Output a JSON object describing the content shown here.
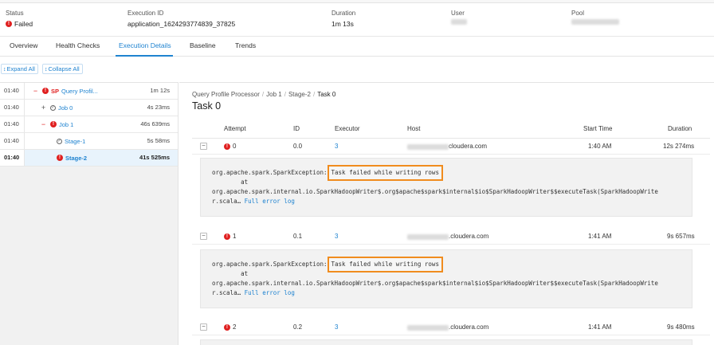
{
  "summary": {
    "status_label": "Status",
    "status_value": "Failed",
    "execution_id_label": "Execution ID",
    "execution_id_value": "application_1624293774839_37825",
    "duration_label": "Duration",
    "duration_value": "1m 13s",
    "user_label": "User",
    "pool_label": "Pool"
  },
  "tabs": [
    "Overview",
    "Health Checks",
    "Execution Details",
    "Baseline",
    "Trends"
  ],
  "toolbar": {
    "expand_all": "Expand All",
    "collapse_all": "Collapse All"
  },
  "tree": [
    {
      "time": "01:40",
      "toggle": "−",
      "prefix": "SP",
      "label": "Query Profil...",
      "duration": "1m 12s"
    },
    {
      "time": "01:40",
      "toggle": "+",
      "label": "Job 0",
      "duration": "4s 23ms"
    },
    {
      "time": "01:40",
      "toggle": "−",
      "label": "Job 1",
      "duration": "46s 639ms"
    },
    {
      "time": "01:40",
      "label": "Stage-1",
      "duration": "5s 58ms"
    },
    {
      "time": "01:40",
      "label": "Stage-2",
      "duration": "41s 525ms"
    }
  ],
  "breadcrumb": [
    "Query Profile Processor",
    "Job 1",
    "Stage-2",
    "Task 0"
  ],
  "task_title": "Task 0",
  "table": {
    "headers": {
      "attempt": "Attempt",
      "id": "ID",
      "executor": "Executor",
      "host": "Host",
      "start_time": "Start Time",
      "duration": "Duration"
    },
    "rows": [
      {
        "attempt": "0",
        "id": "0.0",
        "executor": "3",
        "host_suffix": "cloudera.com",
        "start_time": "1:40 AM",
        "duration": "12s 274ms"
      },
      {
        "attempt": "1",
        "id": "0.1",
        "executor": "3",
        "host_suffix": ".cloudera.com",
        "start_time": "1:41 AM",
        "duration": "9s 657ms"
      },
      {
        "attempt": "2",
        "id": "0.2",
        "executor": "3",
        "host_suffix": ".cloudera.com",
        "start_time": "1:41 AM",
        "duration": "9s 480ms"
      }
    ]
  },
  "error": {
    "exception": "org.apache.spark.SparkException:",
    "message": "Task failed while writing rows",
    "at": "        at",
    "trace_line": "org.apache.spark.internal.io.SparkHadoopWriter$.org$apache$spark$internal$io$SparkHadoopWriter$$executeTask(SparkHadoopWrite",
    "trace_tail": "r.scala…",
    "full_log": "Full error log"
  },
  "colors": {
    "accent": "#1f83d0",
    "error": "#e02020",
    "highlight": "#f08c1e"
  }
}
